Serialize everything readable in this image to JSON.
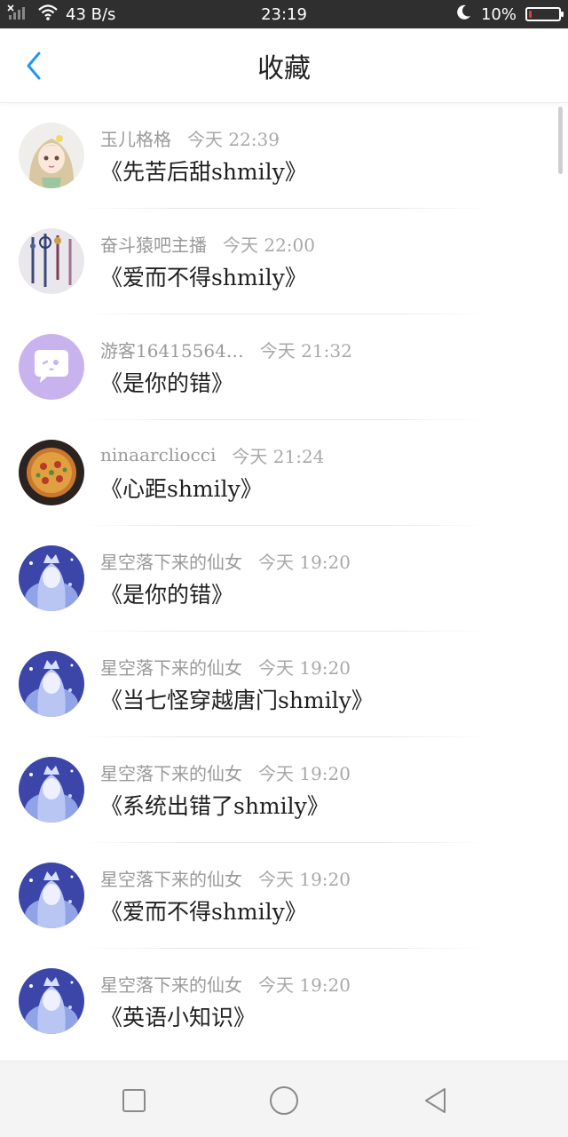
{
  "status_bar": {
    "network_speed": "43 B/s",
    "time": "23:19",
    "battery": "10%",
    "battery_level": 0.1,
    "icons": [
      "no-sim-icon",
      "signal-icon",
      "wifi-icon",
      "moon-icon",
      "battery-icon"
    ]
  },
  "header": {
    "title": "收藏",
    "back_icon": "chevron-left-icon"
  },
  "colors": {
    "accent": "#2196f3",
    "status_bar": "#2f2f2f",
    "battery_low": "#e23b3b"
  },
  "favorites": [
    {
      "user": "玉儿格格",
      "time": "今天 22:39",
      "title": "《先苦后甜shmily》",
      "avatar": "anime-girl-blonde"
    },
    {
      "user": "奋斗猿吧主播",
      "time": "今天 22:00",
      "title": "《爱而不得shmily》",
      "avatar": "hanging-tassels"
    },
    {
      "user": "游客16415564…",
      "time": "今天 21:32",
      "title": "《是你的错》",
      "avatar": "purple-chat-bubble"
    },
    {
      "user": "ninaarcliocci",
      "time": "今天 21:24",
      "title": "《心距shmily》",
      "avatar": "pizza"
    },
    {
      "user": "星空落下来的仙女",
      "time": "今天 19:20",
      "title": "《是你的错》",
      "avatar": "anime-fairy-blue"
    },
    {
      "user": "星空落下来的仙女",
      "time": "今天 19:20",
      "title": "《当七怪穿越唐门shmily》",
      "avatar": "anime-fairy-blue"
    },
    {
      "user": "星空落下来的仙女",
      "time": "今天 19:20",
      "title": "《系统出错了shmily》",
      "avatar": "anime-fairy-blue"
    },
    {
      "user": "星空落下来的仙女",
      "time": "今天 19:20",
      "title": "《爱而不得shmily》",
      "avatar": "anime-fairy-blue"
    },
    {
      "user": "星空落下来的仙女",
      "time": "今天 19:20",
      "title": "《英语小知识》",
      "avatar": "anime-fairy-blue"
    }
  ],
  "nav_bar": {
    "buttons": [
      "recents-square-icon",
      "home-circle-icon",
      "back-triangle-icon"
    ]
  }
}
